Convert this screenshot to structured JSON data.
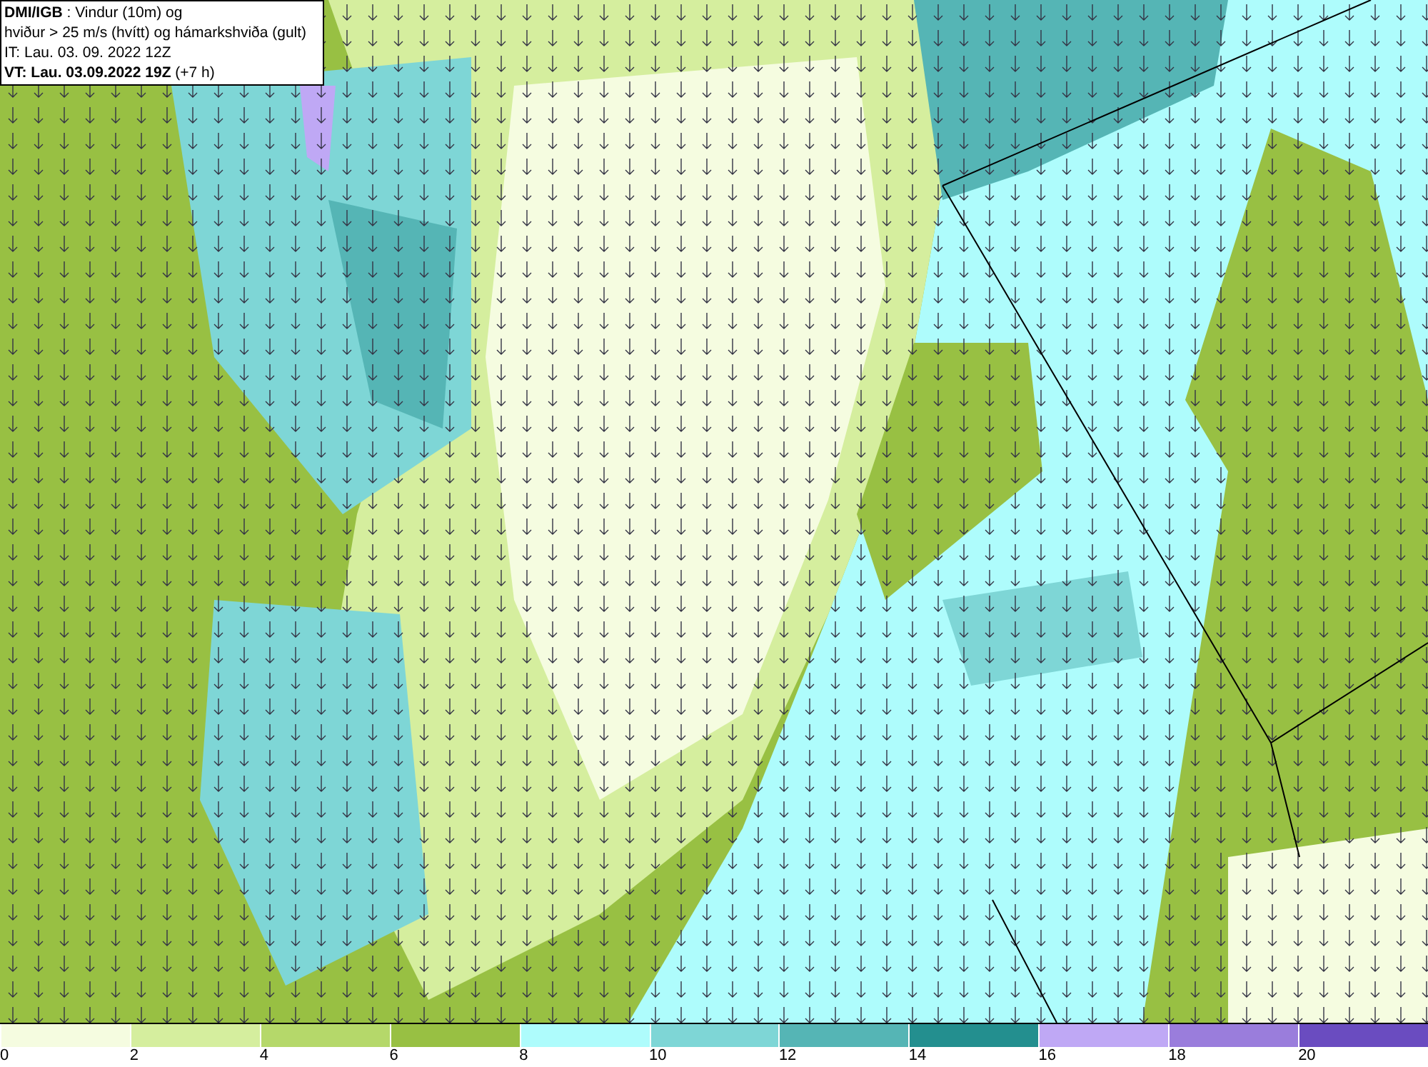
{
  "info_box": {
    "lines": [
      "**DMI/IGB** : Vindur (10m) og",
      "hviður > 25 m/s (hvítt) og hámarkshviða (gult)",
      "IT: Lau. 03. 09. 2022 12Z",
      "**VT: Lau. 03.09.2022 19Z** (+7 h)"
    ]
  },
  "legend": [
    {
      "label": "0",
      "color": "#f5fce0"
    },
    {
      "label": "2",
      "color": "#d5ee9e"
    },
    {
      "label": "4",
      "color": "#b5d86a"
    },
    {
      "label": "6",
      "color": "#98c043"
    },
    {
      "label": "8",
      "color": "#aefcfc"
    },
    {
      "label": "10",
      "color": "#7ed6d6"
    },
    {
      "label": "12",
      "color": "#55b5b5"
    },
    {
      "label": "14",
      "color": "#238f8f"
    },
    {
      "label": "16",
      "color": "#bfa8f5"
    },
    {
      "label": "18",
      "color": "#9a7ddc"
    },
    {
      "label": "20",
      "color": "#6a4cc0"
    }
  ]
}
